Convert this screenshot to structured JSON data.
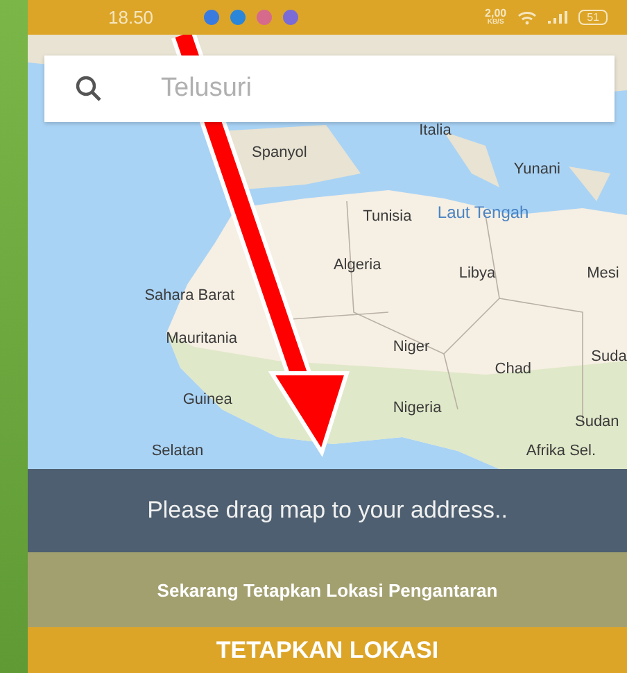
{
  "status_bar": {
    "time": "18.50",
    "net_speed": "2,00",
    "net_unit": "KB/S",
    "battery": "51"
  },
  "search": {
    "placeholder": "Telusuri"
  },
  "map": {
    "labels": [
      {
        "text": "Italia",
        "kind": "country"
      },
      {
        "text": "Spanyol",
        "kind": "country"
      },
      {
        "text": "Yunani",
        "kind": "country"
      },
      {
        "text": "Tunisia",
        "kind": "country"
      },
      {
        "text": "Laut Tengah",
        "kind": "sea"
      },
      {
        "text": "Algeria",
        "kind": "country"
      },
      {
        "text": "Libya",
        "kind": "country"
      },
      {
        "text": "Mesi",
        "kind": "country"
      },
      {
        "text": "Sahara Barat",
        "kind": "country"
      },
      {
        "text": "Mauritania",
        "kind": "country"
      },
      {
        "text": "Niger",
        "kind": "country"
      },
      {
        "text": "Chad",
        "kind": "country"
      },
      {
        "text": "Suda",
        "kind": "country"
      },
      {
        "text": "Guinea",
        "kind": "country"
      },
      {
        "text": "Nigeria",
        "kind": "country"
      },
      {
        "text": "Sudan",
        "kind": "country"
      },
      {
        "text": "Selatan",
        "kind": "country"
      },
      {
        "text": "Afrika Sel.",
        "kind": "country"
      }
    ]
  },
  "hint": "Please drag map to your address..",
  "instruction": "Sekarang Tetapkan Lokasi Pengantaran",
  "button": "TETAPKAN LOKASI"
}
